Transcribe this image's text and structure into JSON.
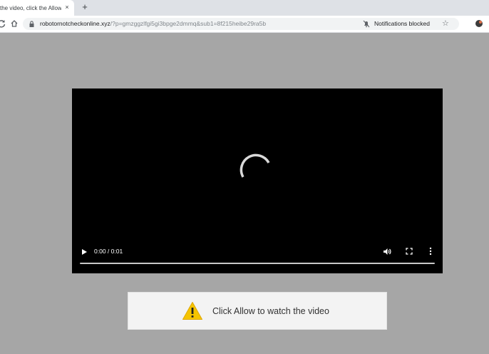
{
  "browser": {
    "tab_title": "the video, click the Allow",
    "tab_close": "×",
    "new_tab": "+",
    "url_host": "robotornotcheckonline.xyz",
    "url_rest": "/?p=gmzggzlfgi5gi3bpge2dmmq&sub1=8f215heibe29ra5b",
    "notifications_status": "Notifications blocked",
    "reload_icon": "reload-icon",
    "home_icon": "home-icon",
    "star_icon": "star-icon"
  },
  "video": {
    "time": "0:00 / 0:01",
    "progress": 0
  },
  "banner": {
    "text": "Click Allow to watch the video",
    "warning_color": "#f5c400"
  }
}
